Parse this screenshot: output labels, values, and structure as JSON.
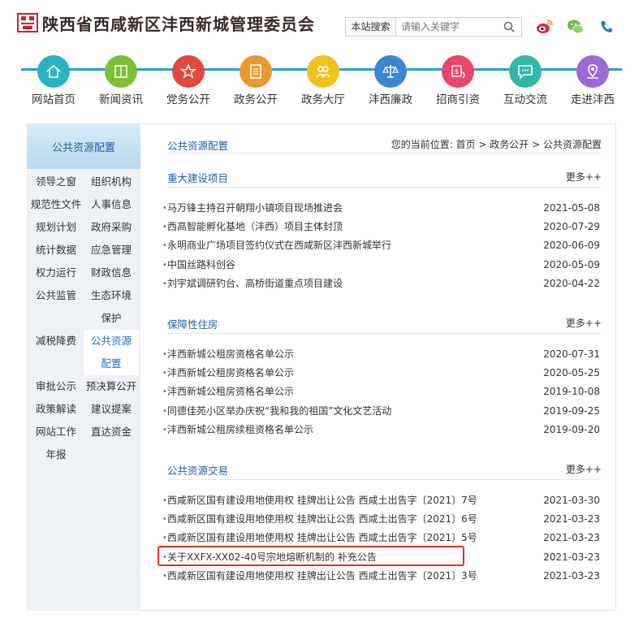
{
  "header": {
    "site_title": "陕西省西咸新区沣西新城管理委员会",
    "search_label": "本站搜索",
    "search_placeholder": "请输入关键字"
  },
  "nav": {
    "items": [
      {
        "label": "网站首页",
        "color": "#2bb3c0",
        "icon": "home-icon"
      },
      {
        "label": "新闻资讯",
        "color": "#7cc03a",
        "icon": "book-icon"
      },
      {
        "label": "党务公开",
        "color": "#e04a3c",
        "icon": "star-icon"
      },
      {
        "label": "政务公开",
        "color": "#e89a2c",
        "icon": "document-icon"
      },
      {
        "label": "政务大厅",
        "color": "#f1c21c",
        "icon": "people-icon"
      },
      {
        "label": "沣西廉政",
        "color": "#3a86d4",
        "icon": "scale-icon"
      },
      {
        "label": "招商引资",
        "color": "#e8466a",
        "icon": "money-icon"
      },
      {
        "label": "互动交流",
        "color": "#33b7a8",
        "icon": "chat-icon"
      },
      {
        "label": "走进沣西",
        "color": "#9a6ad0",
        "icon": "map-pin-icon"
      }
    ]
  },
  "sidebar": {
    "title": "公共资源配置",
    "items": [
      {
        "label": "领导之窗"
      },
      {
        "label": "组织机构"
      },
      {
        "label": "规范性文件"
      },
      {
        "label": "人事信息"
      },
      {
        "label": "规划计划"
      },
      {
        "label": "政府采购"
      },
      {
        "label": "统计数据"
      },
      {
        "label": "应急管理"
      },
      {
        "label": "权力运行"
      },
      {
        "label": "财政信息"
      },
      {
        "label": "公共监管"
      },
      {
        "label": "生态环境保护"
      },
      {
        "label": "减税降费"
      },
      {
        "label": "公共资源配置"
      },
      {
        "label": "审批公示"
      },
      {
        "label": "预决算公开"
      },
      {
        "label": "政策解读"
      },
      {
        "label": "建议提案"
      },
      {
        "label": "网站工作年报"
      },
      {
        "label": "直达资金"
      }
    ]
  },
  "breadcrumb": {
    "title": "公共资源配置",
    "path": "您的当前位置: 首页 > 政务公开 > 公共资源配置"
  },
  "sections": [
    {
      "title": "重大建设项目",
      "more": "更多++",
      "items": [
        {
          "title": "马万锋主持召开朝翔小镇项目现场推进会",
          "date": "2021-05-08"
        },
        {
          "title": "西高智能孵化基地（沣西）项目主体封顶",
          "date": "2020-07-29"
        },
        {
          "title": "永明商业广场项目签约仪式在西咸新区沣西新城举行",
          "date": "2020-06-09"
        },
        {
          "title": "中国丝路科创谷",
          "date": "2020-05-09"
        },
        {
          "title": "刘宇斌调研钓台、高桥街道重点项目建设",
          "date": "2020-04-22"
        }
      ]
    },
    {
      "title": "保障性住房",
      "more": "更多++",
      "items": [
        {
          "title": "沣西新城公租房资格名单公示",
          "date": "2020-07-31"
        },
        {
          "title": "沣西新城公租房资格名单公示",
          "date": "2020-05-25"
        },
        {
          "title": "沣西新城公租房资格名单公示",
          "date": "2019-10-08"
        },
        {
          "title": "同德佳苑小区举办庆祝“我和我的祖国”文化文艺活动",
          "date": "2019-09-25"
        },
        {
          "title": "沣西新城公租房续租资格名单公示",
          "date": "2019-09-20"
        }
      ]
    },
    {
      "title": "公共资源交易",
      "more": "更多++",
      "items": [
        {
          "title": "西咸新区国有建设用地使用权 挂牌出让公告 西咸土出告字〔2021〕7号",
          "date": "2021-03-30"
        },
        {
          "title": "西咸新区国有建设用地使用权 挂牌出让公告 西咸土出告字〔2021〕6号",
          "date": "2021-03-23"
        },
        {
          "title": "西咸新区国有建设用地使用权 挂牌出让公告 西咸土出告字〔2021〕5号",
          "date": "2021-03-23"
        },
        {
          "title": "关于XXFX-XX02-40号宗地熔断机制的 补充公告",
          "date": "2021-03-23"
        },
        {
          "title": "西咸新区国有建设用地使用权 挂牌出让公告 西咸土出告字〔2021〕3号",
          "date": "2021-03-23"
        }
      ]
    }
  ]
}
